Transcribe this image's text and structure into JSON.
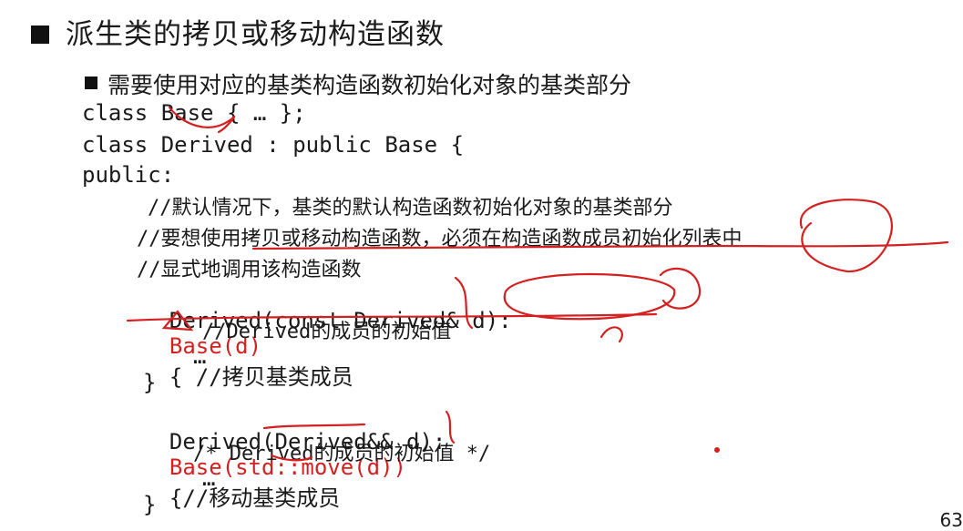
{
  "title": "派生类的拷贝或移动构造函数",
  "subtitle": "需要使用对应的基类构造函数初始化对象的基类部分",
  "code": {
    "l1": "class Base { … };",
    "l2": "class Derived : public Base {",
    "l3": "public:",
    "c1": "//默认情况下，基类的默认构造函数初始化对象的基类部分",
    "c2": "//要想使用拷贝或移动构造函数，必须在构造函数成员初始化列表中",
    "c3": "//显式地调用该构造函数",
    "copy_sig": "Derived(const Derived& d):",
    "copy_init": "Base(d)",
    "copy_tail": "{ //拷贝基类成员",
    "copy_comment": "//Derived的成员的初始值",
    "dots1": "…",
    "close1": "}",
    "move_sig": "Derived(Derived&& d):",
    "move_init": "Base(std::move(d))",
    "move_tail": "{//移动基类成员",
    "move_comment": "/* Derived的成员的初始值 */",
    "dots2": "…",
    "close2": "}"
  },
  "page_number": "63",
  "colors": {
    "accent": "#d42020",
    "text": "#1a1a1a"
  }
}
